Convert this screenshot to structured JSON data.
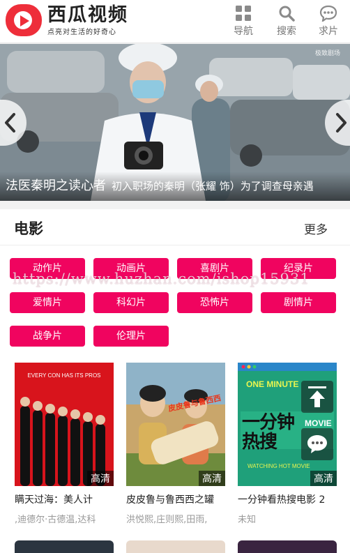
{
  "header": {
    "logo_title": "西瓜视频",
    "logo_slogan": "点亮对生活的好奇心",
    "nav": [
      {
        "label": "导航",
        "icon": "grid-icon"
      },
      {
        "label": "搜索",
        "icon": "search-icon"
      },
      {
        "label": "求片",
        "icon": "chat-bubble-icon"
      }
    ]
  },
  "banner": {
    "title": "法医秦明之读心者",
    "desc": "初入职场的秦明（张耀 饰）为了调查母亲遇",
    "corner_logo": "极致剧场"
  },
  "section": {
    "title": "电影",
    "more": "更多",
    "tags": [
      "动作片",
      "动画片",
      "喜剧片",
      "纪录片",
      "爱情片",
      "科幻片",
      "恐怖片",
      "剧情片",
      "战争片",
      "伦理片"
    ]
  },
  "watermark": "https://www.huzhan.com/ishop15931",
  "movies": [
    {
      "title": "瞒天过海：美人计",
      "cast": ",迪德尔·古德温,达科",
      "badge": "高清"
    },
    {
      "title": "皮皮鲁与鲁西西之罐",
      "cast": "洪悦熙,庄则熙,田雨,",
      "badge": "高清"
    },
    {
      "title": "一分钟看热搜电影 2",
      "cast": "未知",
      "badge": "高清"
    }
  ],
  "poster_texts": {
    "p1_tagline": "EVERY CON HAS ITS PROS",
    "p2_title": "皮皮鲁与鲁西西",
    "p3_line1": "ONE MINUTE",
    "p3_cn": "一分钟热搜",
    "p3_movie": "MOVIE",
    "p3_line2": "WATCHING HOT MOVIE"
  },
  "colors": {
    "accent": "#f0045f",
    "logo_red": "#ee2e3a"
  }
}
